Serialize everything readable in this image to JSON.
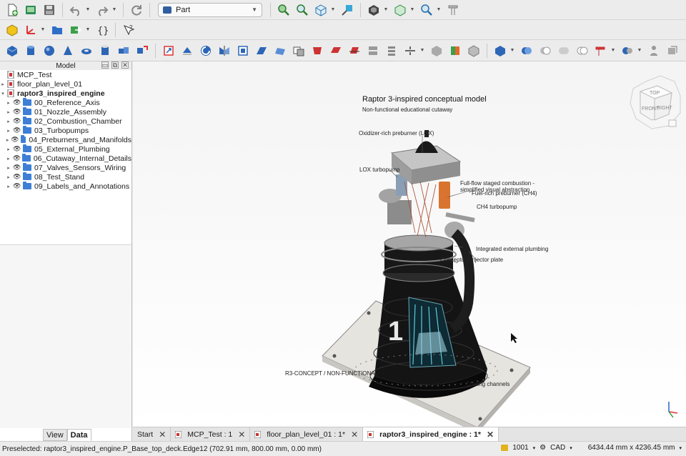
{
  "toolbar": {
    "workbench": "Part"
  },
  "combo": {
    "title": "Model",
    "tabs": {
      "view": "View",
      "data": "Data"
    }
  },
  "tree": {
    "docs": [
      "MCP_Test",
      "floor_plan_level_01",
      "raptor3_inspired_engine"
    ],
    "groups": [
      "00_Reference_Axis",
      "01_Nozzle_Assembly",
      "02_Combustion_Chamber",
      "03_Turbopumps",
      "04_Preburners_and_Manifolds",
      "05_External_Plumbing",
      "06_Cutaway_Internal_Details",
      "07_Valves_Sensors_Wiring",
      "08_Test_Stand",
      "09_Labels_and_Annotations"
    ]
  },
  "viewport": {
    "title": "Raptor 3-inspired conceptual model",
    "subtitle": "Non-functional educational cutaway",
    "labels": {
      "ox_preburner": "Oxidizer-rich preburner (LOX)",
      "lox_turbopump": "LOX turbopump",
      "ffsc": "Full-flow staged combustion - simplified visual abstraction",
      "fuel_preburner": "Fuel-rich preburner (CH4)",
      "ch4_turbopump": "CH4 turbopump",
      "plumbing": "Integrated external plumbing",
      "injector": "Conceptual injector plate",
      "concept": "R3-CONCEPT / NON-FUNCTIONAL",
      "cooling": "Cooling channels",
      "number": "1"
    },
    "navcube": {
      "top": "TOP",
      "front": "FRONT",
      "right": "RIGHT"
    }
  },
  "doc_tabs": [
    "Start",
    "MCP_Test : 1",
    "floor_plan_level_01 : 1*",
    "raptor3_inspired_engine : 1*"
  ],
  "status": {
    "message": "Preselected: raptor3_inspired_engine.P_Base_top_deck.Edge12 (702.91 mm, 800.00 mm, 0.00 mm)",
    "memory": "1001",
    "nav_style": "CAD",
    "dimensions": "6434.44 mm x 4236.45 mm"
  },
  "colors": {
    "accent": "#2f5f9e",
    "folder": "#3d7fd6",
    "engine": "#151515"
  }
}
